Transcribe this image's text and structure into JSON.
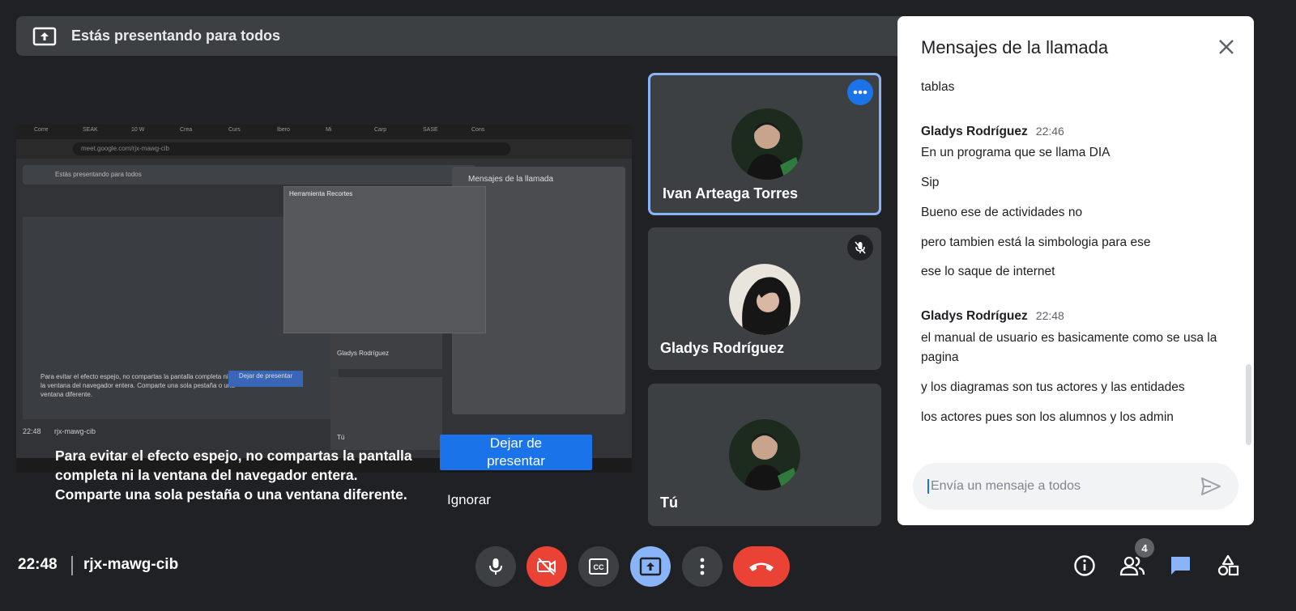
{
  "banner": {
    "text": "Estás presentando para todos"
  },
  "presentation": {
    "tabs": [
      "Corre",
      "SEAK",
      "10 W",
      "Crea",
      "Curs",
      "Ibero",
      "Mi",
      "Carp",
      "SASE",
      "Cons"
    ],
    "url": "meet.google.com/rjx-mawg-cib",
    "inner_banner": "Estás presentando para todos",
    "inner_warning": "Para evitar el efecto espejo, no compartas la pantalla completa ni la ventana del navegador entera. Comparte una sola pestaña o una ventana diferente.",
    "inner_button": "Dejar de presentar",
    "popup_title": "Herramienta Recortes",
    "inner_chat_title": "Mensajes de la llamada",
    "inner_tile_name": "Gladys Rodríguez",
    "inner_tile_you": "Tú",
    "inner_clock": "22:48",
    "inner_code": "rjx-mawg-cib"
  },
  "overlay": {
    "warning_line1": "Para evitar el efecto espejo, no compartas la pantalla",
    "warning_line2": "completa ni la ventana del navegador entera.",
    "warning_line3": "Comparte una sola pestaña o una ventana diferente.",
    "stop_line1": "Dejar de",
    "stop_line2": "presentar",
    "ignore": "Ignorar"
  },
  "participants": [
    {
      "name": "Ivan Arteaga Torres"
    },
    {
      "name": "Gladys Rodríguez"
    },
    {
      "name": "Tú"
    }
  ],
  "chat": {
    "title": "Mensajes de la llamada",
    "messages": [
      {
        "text": "tablas"
      },
      {
        "sender": "Gladys Rodríguez",
        "time": "22:46"
      },
      {
        "text": "En un programa que se llama DIA"
      },
      {
        "text": "Sip"
      },
      {
        "text": "Bueno ese de actividades no"
      },
      {
        "text": "pero tambien está la simbologia para ese"
      },
      {
        "text": "ese lo saque de internet"
      },
      {
        "sender": "Gladys Rodríguez",
        "time": "22:48"
      },
      {
        "text": "el manual de usuario es basicamente como se usa la pagina"
      },
      {
        "text": "y los diagramas son tus actores y las entidades"
      },
      {
        "text": "los actores pues son los alumnos y los admin"
      }
    ],
    "input_placeholder": "Envía un mensaje a todos"
  },
  "bottom_bar": {
    "time": "22:48",
    "meeting_code": "rjx-mawg-cib",
    "participant_count": "4"
  },
  "colors": {
    "background": "#202124",
    "accent_blue": "#1a73e8",
    "light_blue": "#8ab4f8",
    "red": "#ea4335"
  }
}
